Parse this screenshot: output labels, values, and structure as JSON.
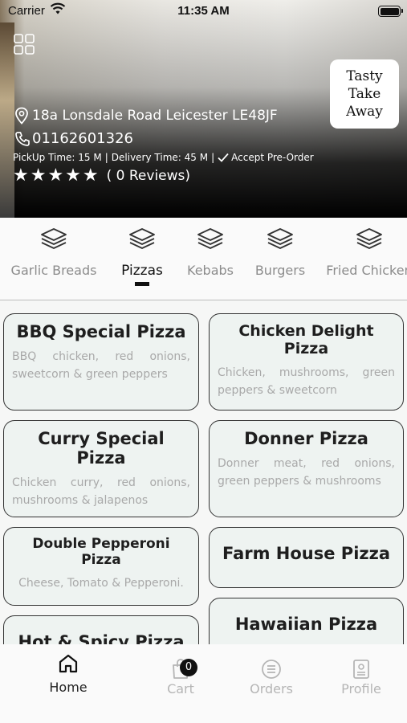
{
  "status_bar": {
    "carrier": "Carrier",
    "time": "11:35 AM"
  },
  "restaurant": {
    "logo_text_line1": "Tasty",
    "logo_text_line2": "Take Away",
    "address": "18a Lonsdale Road Leicester LE48JF",
    "phone": "01162601326",
    "pickup_time": "PickUp Time: 15 M",
    "delivery_time": "Delivery Time: 45 M",
    "preorder": "Accept Pre-Order",
    "stars": "★★★★★",
    "reviews": "( 0 Reviews)"
  },
  "categories": [
    {
      "label": "Garlic Breads",
      "active": false
    },
    {
      "label": "Pizzas",
      "active": true
    },
    {
      "label": "Kebabs",
      "active": false
    },
    {
      "label": "Burgers",
      "active": false
    },
    {
      "label": "Fried Chicken",
      "active": false
    }
  ],
  "items": [
    {
      "title": "BBQ Special Pizza",
      "desc": "BBQ chicken, red onions, sweetcorn & green peppers"
    },
    {
      "title": "Chicken Delight Pizza",
      "desc": "Chicken, mushrooms, green peppers & sweetcorn"
    },
    {
      "title": "Curry Special Pizza",
      "desc": "Chicken curry, red onions, mushrooms & jalapenos"
    },
    {
      "title": "Donner Pizza",
      "desc": "Donner meat, red onions, green peppers & mushrooms"
    },
    {
      "title": "Double Pepperoni Pizza",
      "desc": "Cheese, Tomato & Pepperoni."
    },
    {
      "title": "Farm House Pizza",
      "desc": ""
    },
    {
      "title": "Hot & Spicy Pizza",
      "desc": ""
    },
    {
      "title": "Hawaiian Pizza",
      "desc": ""
    }
  ],
  "tabbar": {
    "home": "Home",
    "cart": "Cart",
    "cart_count": "0",
    "orders": "Orders",
    "profile": "Profile"
  },
  "icons": {
    "menu_grid": "grid-icon",
    "location": "location-pin-icon",
    "phone": "phone-icon",
    "check": "check-icon",
    "category": "layers-icon",
    "home": "home-icon",
    "cart": "shopping-bag-icon",
    "orders": "list-circle-icon",
    "profile": "id-card-icon"
  }
}
